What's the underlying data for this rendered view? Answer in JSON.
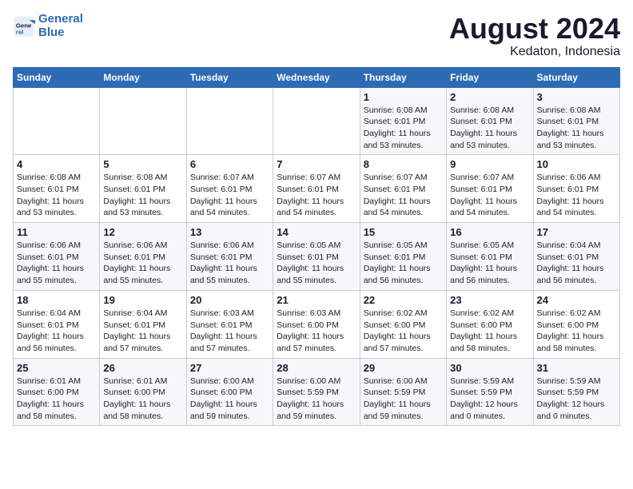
{
  "header": {
    "logo_line1": "General",
    "logo_line2": "Blue",
    "month_year": "August 2024",
    "location": "Kedaton, Indonesia"
  },
  "weekdays": [
    "Sunday",
    "Monday",
    "Tuesday",
    "Wednesday",
    "Thursday",
    "Friday",
    "Saturday"
  ],
  "weeks": [
    [
      {
        "day": "",
        "info": ""
      },
      {
        "day": "",
        "info": ""
      },
      {
        "day": "",
        "info": ""
      },
      {
        "day": "",
        "info": ""
      },
      {
        "day": "1",
        "info": "Sunrise: 6:08 AM\nSunset: 6:01 PM\nDaylight: 11 hours\nand 53 minutes."
      },
      {
        "day": "2",
        "info": "Sunrise: 6:08 AM\nSunset: 6:01 PM\nDaylight: 11 hours\nand 53 minutes."
      },
      {
        "day": "3",
        "info": "Sunrise: 6:08 AM\nSunset: 6:01 PM\nDaylight: 11 hours\nand 53 minutes."
      }
    ],
    [
      {
        "day": "4",
        "info": "Sunrise: 6:08 AM\nSunset: 6:01 PM\nDaylight: 11 hours\nand 53 minutes."
      },
      {
        "day": "5",
        "info": "Sunrise: 6:08 AM\nSunset: 6:01 PM\nDaylight: 11 hours\nand 53 minutes."
      },
      {
        "day": "6",
        "info": "Sunrise: 6:07 AM\nSunset: 6:01 PM\nDaylight: 11 hours\nand 54 minutes."
      },
      {
        "day": "7",
        "info": "Sunrise: 6:07 AM\nSunset: 6:01 PM\nDaylight: 11 hours\nand 54 minutes."
      },
      {
        "day": "8",
        "info": "Sunrise: 6:07 AM\nSunset: 6:01 PM\nDaylight: 11 hours\nand 54 minutes."
      },
      {
        "day": "9",
        "info": "Sunrise: 6:07 AM\nSunset: 6:01 PM\nDaylight: 11 hours\nand 54 minutes."
      },
      {
        "day": "10",
        "info": "Sunrise: 6:06 AM\nSunset: 6:01 PM\nDaylight: 11 hours\nand 54 minutes."
      }
    ],
    [
      {
        "day": "11",
        "info": "Sunrise: 6:06 AM\nSunset: 6:01 PM\nDaylight: 11 hours\nand 55 minutes."
      },
      {
        "day": "12",
        "info": "Sunrise: 6:06 AM\nSunset: 6:01 PM\nDaylight: 11 hours\nand 55 minutes."
      },
      {
        "day": "13",
        "info": "Sunrise: 6:06 AM\nSunset: 6:01 PM\nDaylight: 11 hours\nand 55 minutes."
      },
      {
        "day": "14",
        "info": "Sunrise: 6:05 AM\nSunset: 6:01 PM\nDaylight: 11 hours\nand 55 minutes."
      },
      {
        "day": "15",
        "info": "Sunrise: 6:05 AM\nSunset: 6:01 PM\nDaylight: 11 hours\nand 56 minutes."
      },
      {
        "day": "16",
        "info": "Sunrise: 6:05 AM\nSunset: 6:01 PM\nDaylight: 11 hours\nand 56 minutes."
      },
      {
        "day": "17",
        "info": "Sunrise: 6:04 AM\nSunset: 6:01 PM\nDaylight: 11 hours\nand 56 minutes."
      }
    ],
    [
      {
        "day": "18",
        "info": "Sunrise: 6:04 AM\nSunset: 6:01 PM\nDaylight: 11 hours\nand 56 minutes."
      },
      {
        "day": "19",
        "info": "Sunrise: 6:04 AM\nSunset: 6:01 PM\nDaylight: 11 hours\nand 57 minutes."
      },
      {
        "day": "20",
        "info": "Sunrise: 6:03 AM\nSunset: 6:01 PM\nDaylight: 11 hours\nand 57 minutes."
      },
      {
        "day": "21",
        "info": "Sunrise: 6:03 AM\nSunset: 6:00 PM\nDaylight: 11 hours\nand 57 minutes."
      },
      {
        "day": "22",
        "info": "Sunrise: 6:02 AM\nSunset: 6:00 PM\nDaylight: 11 hours\nand 57 minutes."
      },
      {
        "day": "23",
        "info": "Sunrise: 6:02 AM\nSunset: 6:00 PM\nDaylight: 11 hours\nand 58 minutes."
      },
      {
        "day": "24",
        "info": "Sunrise: 6:02 AM\nSunset: 6:00 PM\nDaylight: 11 hours\nand 58 minutes."
      }
    ],
    [
      {
        "day": "25",
        "info": "Sunrise: 6:01 AM\nSunset: 6:00 PM\nDaylight: 11 hours\nand 58 minutes."
      },
      {
        "day": "26",
        "info": "Sunrise: 6:01 AM\nSunset: 6:00 PM\nDaylight: 11 hours\nand 58 minutes."
      },
      {
        "day": "27",
        "info": "Sunrise: 6:00 AM\nSunset: 6:00 PM\nDaylight: 11 hours\nand 59 minutes."
      },
      {
        "day": "28",
        "info": "Sunrise: 6:00 AM\nSunset: 5:59 PM\nDaylight: 11 hours\nand 59 minutes."
      },
      {
        "day": "29",
        "info": "Sunrise: 6:00 AM\nSunset: 5:59 PM\nDaylight: 11 hours\nand 59 minutes."
      },
      {
        "day": "30",
        "info": "Sunrise: 5:59 AM\nSunset: 5:59 PM\nDaylight: 12 hours\nand 0 minutes."
      },
      {
        "day": "31",
        "info": "Sunrise: 5:59 AM\nSunset: 5:59 PM\nDaylight: 12 hours\nand 0 minutes."
      }
    ]
  ]
}
